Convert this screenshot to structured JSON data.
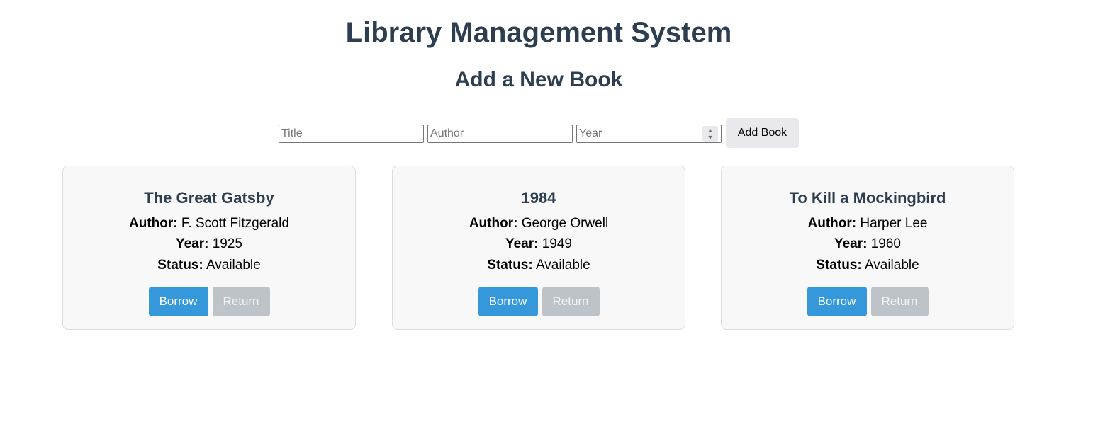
{
  "header": {
    "title": "Library Management System"
  },
  "add_form": {
    "heading": "Add a New Book",
    "title_placeholder": "Title",
    "author_placeholder": "Author",
    "year_placeholder": "Year",
    "title_value": "",
    "author_value": "",
    "year_value": "",
    "submit_label": "Add Book"
  },
  "labels": {
    "author": "Author:",
    "year": "Year:",
    "status": "Status:",
    "borrow": "Borrow",
    "return": "Return"
  },
  "books": [
    {
      "title": "The Great Gatsby",
      "author": "F. Scott Fitzgerald",
      "year": "1925",
      "status": "Available"
    },
    {
      "title": "1984",
      "author": "George Orwell",
      "year": "1949",
      "status": "Available"
    },
    {
      "title": "To Kill a Mockingbird",
      "author": "Harper Lee",
      "year": "1960",
      "status": "Available"
    }
  ],
  "colors": {
    "heading": "#2c3e50",
    "borrow_button": "#3498db",
    "return_button_disabled": "#bdc3c7",
    "card_background": "#f8f8f8",
    "card_border": "#dddddd"
  },
  "icons": {
    "year_spinner": "stepper-arrows-icon"
  }
}
